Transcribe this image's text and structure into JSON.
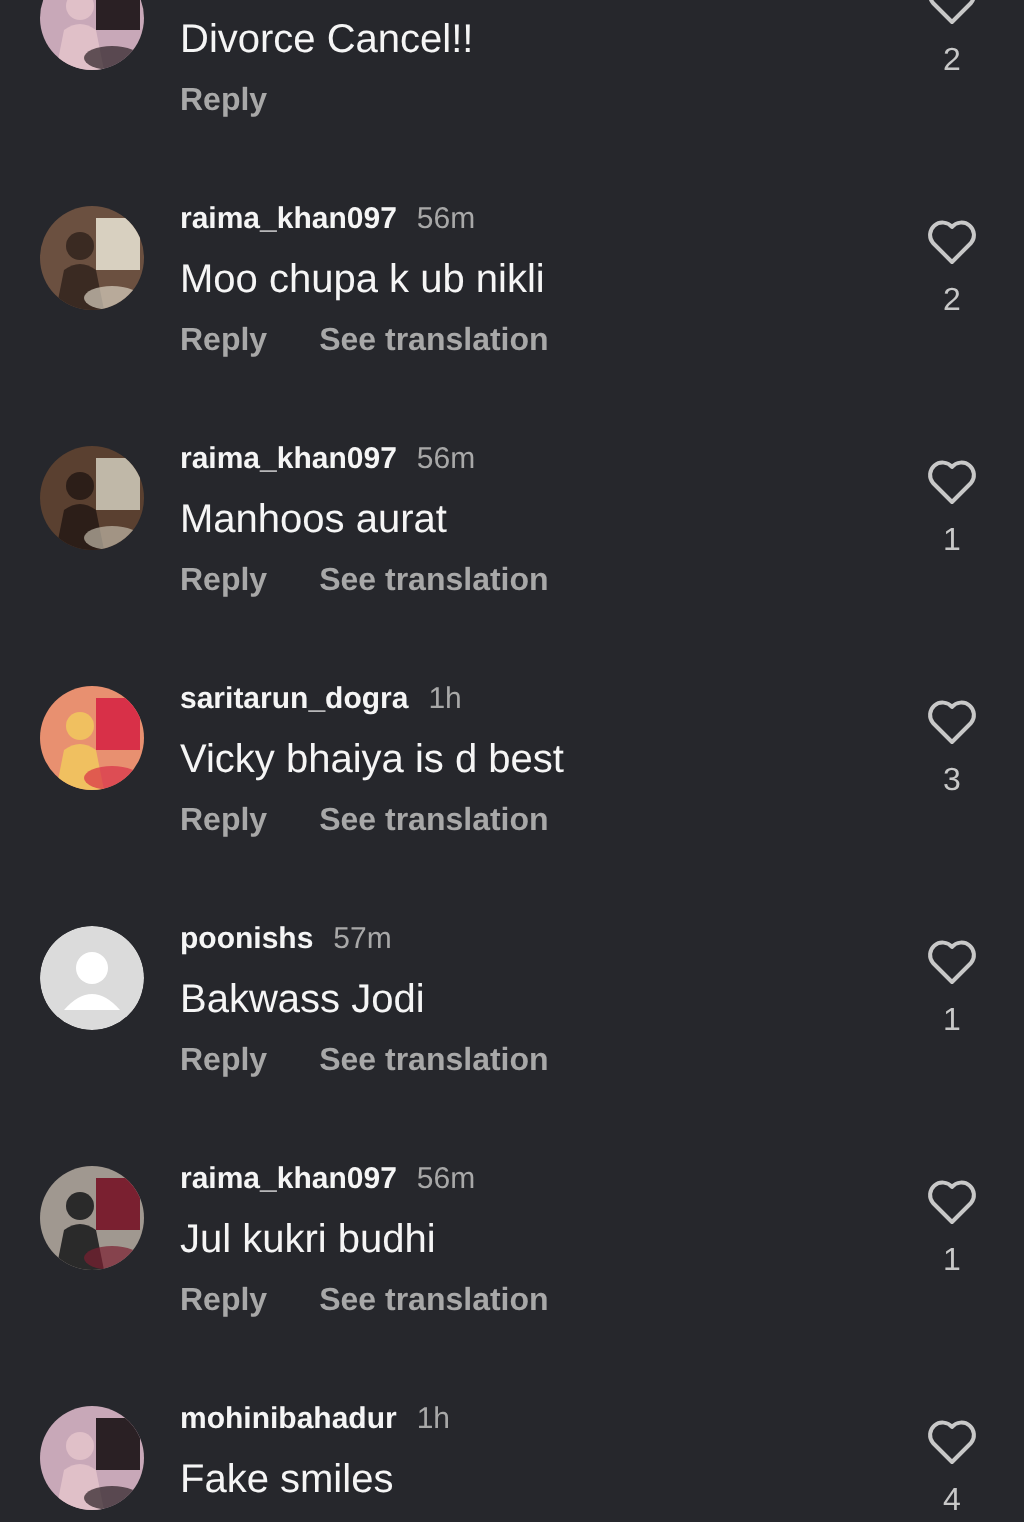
{
  "comments": [
    {
      "avatar": {
        "kind": "picture"
      },
      "text": "Divorce Cancel!!",
      "actions": [
        "Reply"
      ],
      "likes": "2"
    },
    {
      "user": "raima_khan097",
      "time": "56m",
      "avatar": {
        "kind": "picture"
      },
      "text": "Moo chupa k ub nikli",
      "actions": [
        "Reply",
        "See translation"
      ],
      "likes": "2"
    },
    {
      "user": "raima_khan097",
      "time": "56m",
      "avatar": {
        "kind": "picture"
      },
      "text": "Manhoos aurat",
      "actions": [
        "Reply",
        "See translation"
      ],
      "likes": "1"
    },
    {
      "user": "saritarun_dogra",
      "time": "1h",
      "avatar": {
        "kind": "picture"
      },
      "text": "Vicky bhaiya is d best",
      "actions": [
        "Reply",
        "See translation"
      ],
      "likes": "3"
    },
    {
      "user": "poonishs",
      "time": "57m",
      "avatar": {
        "kind": "default"
      },
      "text": "Bakwass Jodi",
      "actions": [
        "Reply",
        "See translation"
      ],
      "likes": "1"
    },
    {
      "user": "raima_khan097",
      "time": "56m",
      "avatar": {
        "kind": "picture"
      },
      "text": "Jul kukri budhi",
      "actions": [
        "Reply",
        "See translation"
      ],
      "likes": "1"
    },
    {
      "user": "mohinibahadur",
      "time": "1h",
      "avatar": {
        "kind": "picture"
      },
      "text": "Fake smiles",
      "likes": "4"
    }
  ]
}
